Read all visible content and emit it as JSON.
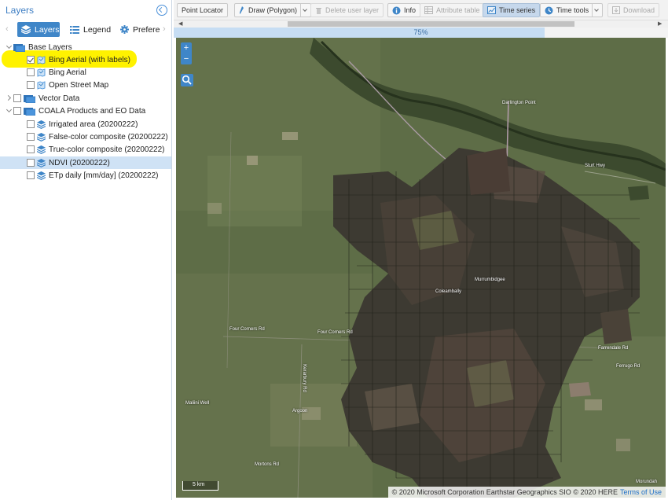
{
  "panel": {
    "title": "Layers"
  },
  "tabs": [
    {
      "label": "Layers",
      "icon": "layers-icon",
      "active": true
    },
    {
      "label": "Legend",
      "icon": "list-icon",
      "active": false
    },
    {
      "label": "Preferer",
      "icon": "gear-icon",
      "active": false
    }
  ],
  "tree": {
    "base_layers": {
      "label": "Base Layers",
      "expanded": true
    },
    "bing_aerial_labels": {
      "label": "Bing Aerial (with labels)",
      "checked": true
    },
    "bing_aerial": {
      "label": "Bing Aerial",
      "checked": false
    },
    "osm": {
      "label": "Open Street Map",
      "checked": false
    },
    "vector_data": {
      "label": "Vector Data",
      "expanded": false
    },
    "coala": {
      "label": "COALA Products and EO Data",
      "expanded": true
    },
    "irrigated": {
      "label": "Irrigated area (20200222)",
      "checked": false
    },
    "false_color": {
      "label": "False-color composite (20200222)",
      "checked": false
    },
    "true_color": {
      "label": "True-color composite (20200222)",
      "checked": false
    },
    "ndvi": {
      "label": "NDVI (20200222)",
      "checked": false,
      "selected": true
    },
    "etp": {
      "label": "ETp daily [mm/day] (20200222)",
      "checked": false
    }
  },
  "toolbar": {
    "point_locator": "Point Locator",
    "draw": "Draw (Polygon)",
    "delete_layer": "Delete user layer",
    "info": "Info",
    "attribute_table": "Attribute table",
    "time_series": "Time series",
    "time_tools": "Time tools",
    "download": "Download"
  },
  "progress": {
    "text": "75%",
    "value": 0.75
  },
  "map": {
    "labels": {
      "darlington": "Darlington Point",
      "murrumbidgee": "Murrumbidgee",
      "coleambally": "Coleambally",
      "four_corners": "Four Corners Rd",
      "four_corners2": "Four Corners Rd",
      "argoon": "Argoon",
      "maliini": "Maliini Well",
      "kerarbury": "Kerarbury Rd",
      "morundah": "Morundah",
      "mortons": "Mortons Rd",
      "farrendale": "Farrendale Rd",
      "sturt": "Sturt Hwy",
      "ferrugo": "Ferrugo Rd"
    },
    "zoom_in": "+",
    "zoom_out": "−",
    "scale": "5 km",
    "attribution": "© 2020 Microsoft Corporation Earthstar Geographics SIO © 2020 HERE",
    "terms": "Terms of Use"
  },
  "colors": {
    "accent": "#3f86c8",
    "highlight": "#fff200",
    "selected_row": "#cfe2f5"
  }
}
